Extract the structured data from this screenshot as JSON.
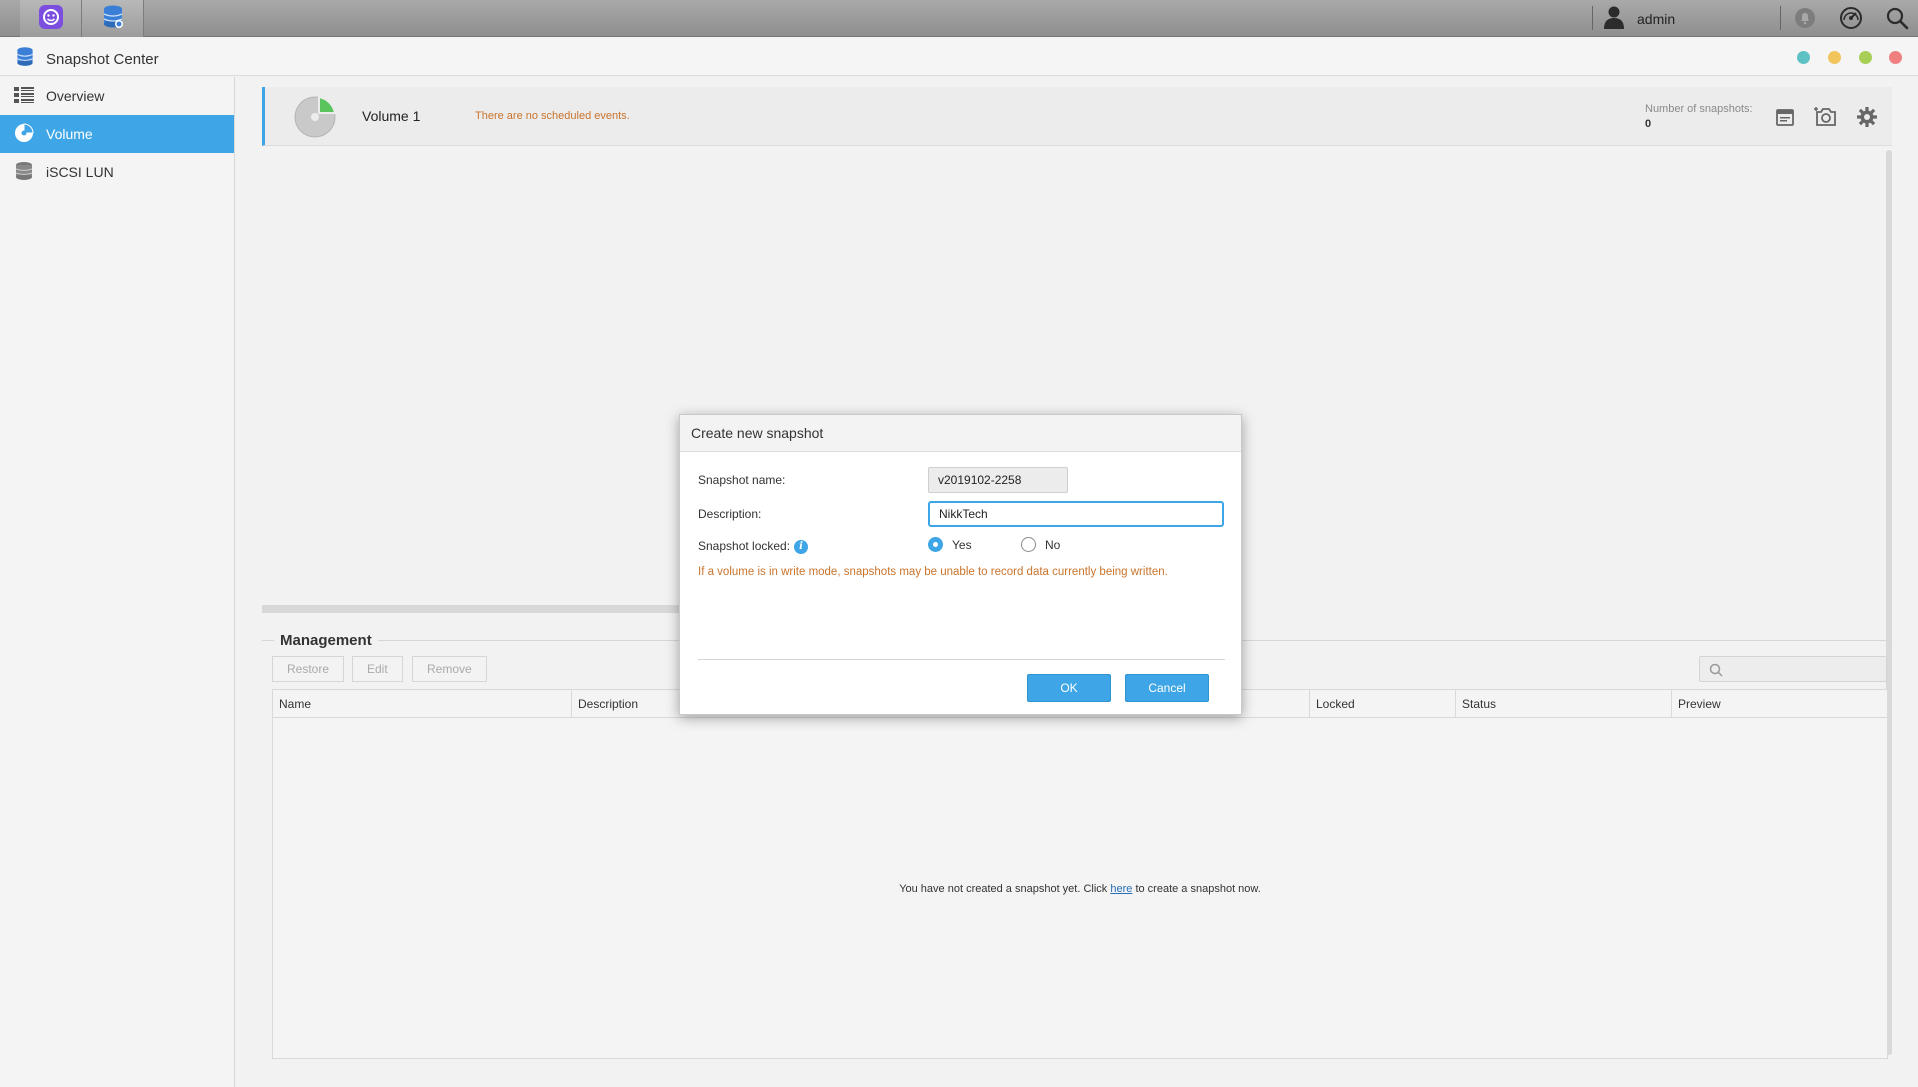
{
  "user": {
    "name": "admin"
  },
  "window": {
    "title": "Snapshot Center"
  },
  "sidebar": {
    "items": [
      {
        "label": "Overview",
        "icon": "list-icon"
      },
      {
        "label": "Volume",
        "icon": "volume-icon",
        "selected": true
      },
      {
        "label": "iSCSI LUN",
        "icon": "lun-icon"
      }
    ]
  },
  "volume": {
    "name": "Volume 1",
    "events": "There are no scheduled events.",
    "snapshot_count_label": "Number of snapshots:",
    "snapshot_count": "0"
  },
  "management": {
    "title": "Management",
    "buttons": {
      "restore": "Restore",
      "edit": "Edit",
      "remove": "Remove"
    },
    "columns": [
      "Name",
      "Description",
      "Locked",
      "Status",
      "Preview"
    ],
    "empty": {
      "before": "You have not created a snapshot yet. Click ",
      "link": "here",
      "after": " to create a snapshot now."
    }
  },
  "dialog": {
    "title": "Create new snapshot",
    "name_label": "Snapshot name:",
    "name_value": "v2019102-2258",
    "description_label": "Description:",
    "description_value": "NikkTech",
    "locked_label": "Snapshot locked:",
    "yes": "Yes",
    "no": "No",
    "locked": "yes",
    "warning": "If a volume is in write mode, snapshots may be unable to record data currently being written.",
    "ok": "OK",
    "cancel": "Cancel"
  },
  "colors": {
    "accent": "#3ea6e6",
    "warning": "#c9742c"
  }
}
